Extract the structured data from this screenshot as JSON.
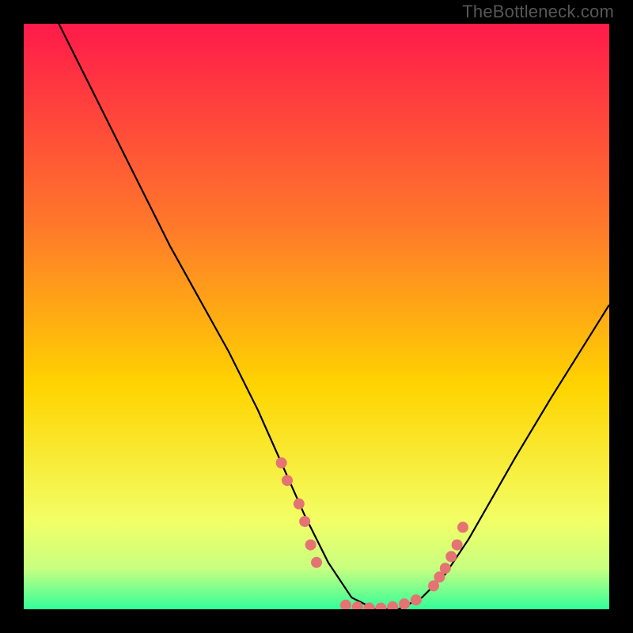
{
  "watermark": "TheBottleneck.com",
  "colors": {
    "gradient_top": "#ff1a4a",
    "gradient_mid": "#ffd400",
    "gradient_bottom": "#33ff99",
    "curve": "#000000",
    "dots": "#e57373"
  },
  "chart_data": {
    "type": "line",
    "title": "",
    "xlabel": "",
    "ylabel": "",
    "xlim": [
      0,
      100
    ],
    "ylim": [
      0,
      100
    ],
    "series": [
      {
        "name": "bottleneck-curve",
        "x": [
          6,
          10,
          15,
          20,
          25,
          30,
          35,
          40,
          44,
          48,
          52,
          56,
          60,
          64,
          68,
          72,
          76,
          80,
          84,
          90,
          95,
          100
        ],
        "y": [
          100,
          92,
          82,
          72,
          62,
          53,
          44,
          34,
          25,
          16,
          8,
          2,
          0,
          0,
          2,
          6,
          12,
          19,
          26,
          36,
          44,
          52
        ]
      }
    ],
    "annotations": {
      "dot_clusters": [
        {
          "name": "left-slope-dots",
          "x": [
            44,
            45,
            47,
            48,
            49,
            50
          ],
          "y": [
            25,
            22,
            18,
            15,
            11,
            8
          ]
        },
        {
          "name": "valley-dots",
          "x": [
            55,
            57,
            59,
            61,
            63,
            65,
            67
          ],
          "y": [
            0.7,
            0.4,
            0.2,
            0.2,
            0.4,
            0.9,
            1.6
          ]
        },
        {
          "name": "right-slope-dots",
          "x": [
            70,
            71,
            72,
            73,
            74,
            75
          ],
          "y": [
            4,
            5.5,
            7,
            9,
            11,
            14
          ]
        }
      ]
    }
  }
}
